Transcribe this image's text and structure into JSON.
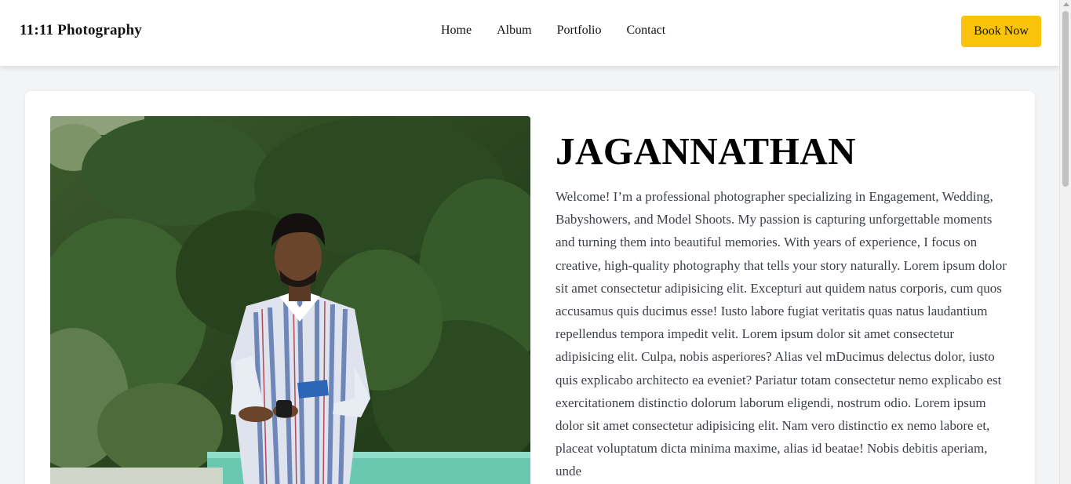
{
  "header": {
    "brand": "11:11 Photography",
    "nav": [
      "Home",
      "Album",
      "Portfolio",
      "Contact"
    ],
    "book_label": "Book Now"
  },
  "profile": {
    "name": "JAGANNATHAN",
    "bio": "Welcome! I’m a professional photographer specializing in Engagement, Wedding, Babyshowers, and Model Shoots. My passion is capturing unforgettable moments and turning them into beautiful memories. With years of experience, I focus on creative, high-quality photography that tells your story naturally. Lorem ipsum dolor sit amet consectetur adipisicing elit. Excepturi aut quidem natus corporis, cum quos accusamus quis ducimus esse! Iusto labore fugiat veritatis quas natus laudantium repellendus tempora impedit velit. Lorem ipsum dolor sit amet consectetur adipisicing elit. Culpa, nobis asperiores? Alias vel mDucimus delectus dolor, iusto quis explicabo architecto ea eveniet? Pariatur totam consectetur nemo explicabo est exercitationem distinctio dolorum laborum eligendi, nostrum odio. Lorem ipsum dolor sit amet consectetur adipisicing elit. Nam vero distinctio ex nemo labore et, placeat voluptatum dicta minima maxime, alias id beatae! Nobis debitis aperiam, unde"
  },
  "colors": {
    "accent": "#fbc30a",
    "page_background": "#f3f4f6",
    "card_background": "#ffffff",
    "body_text": "#3b3f46"
  },
  "icons": {
    "scroll_up": "scroll-up-arrow-icon"
  }
}
